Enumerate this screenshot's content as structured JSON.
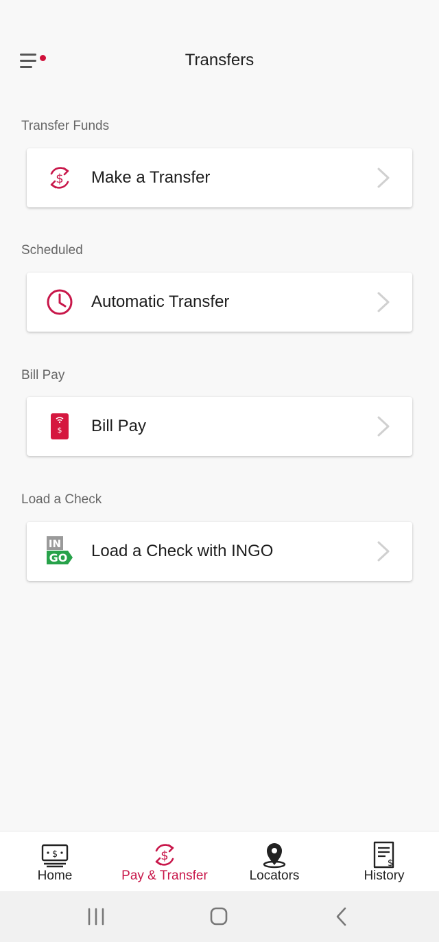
{
  "header": {
    "title": "Transfers",
    "notification_dot_color": "#d0103a"
  },
  "sections": [
    {
      "label": "Transfer Funds",
      "item": {
        "label": "Make a Transfer",
        "icon": "dollar-cycle-icon"
      }
    },
    {
      "label": "Scheduled",
      "item": {
        "label": "Automatic Transfer",
        "icon": "clock-icon"
      }
    },
    {
      "label": "Bill Pay",
      "item": {
        "label": "Bill Pay",
        "icon": "bill-phone-icon"
      }
    },
    {
      "label": "Load a Check",
      "item": {
        "label": "Load a Check with INGO",
        "icon": "ingo-logo-icon"
      }
    }
  ],
  "ingo_logo": {
    "top": "IN",
    "bottom": "GO"
  },
  "bottom_nav": [
    {
      "label": "Home",
      "icon": "cash-icon",
      "active": false
    },
    {
      "label": "Pay & Transfer",
      "icon": "dollar-cycle-icon",
      "active": true
    },
    {
      "label": "Locators",
      "icon": "location-pin-icon",
      "active": false
    },
    {
      "label": "History",
      "icon": "receipt-icon",
      "active": false
    }
  ],
  "colors": {
    "accent": "#c8174a",
    "background": "#f8f8f8",
    "ingo_green": "#27a24a"
  }
}
